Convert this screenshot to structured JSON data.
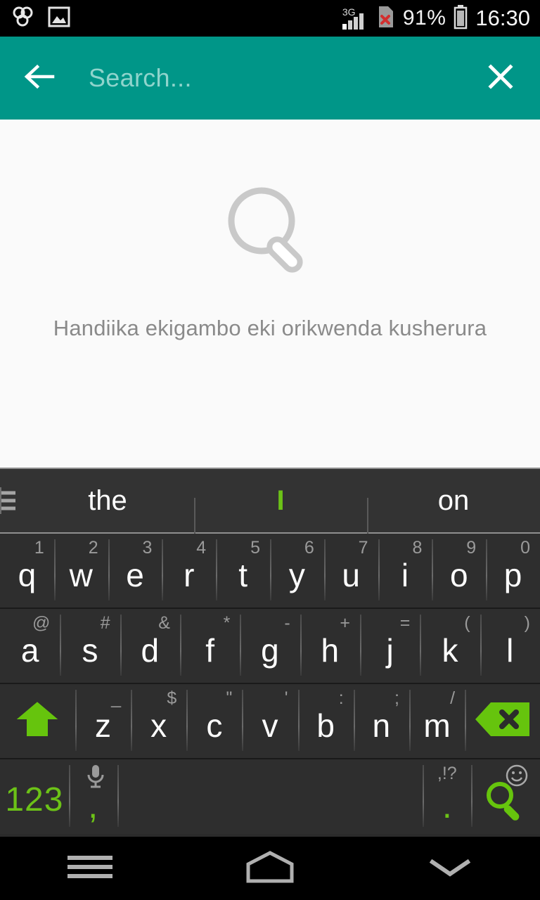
{
  "statusbar": {
    "left_icons": [
      {
        "name": "clover-app-icon"
      },
      {
        "name": "gallery-image-icon"
      }
    ],
    "network_type": "3G",
    "sim_status": "no-sim",
    "battery_percent": "91%",
    "time": "16:30"
  },
  "searchbar": {
    "background_color": "#009688",
    "back_icon": "arrow-left-icon",
    "placeholder": "Search...",
    "value": "",
    "close_icon": "close-x-icon"
  },
  "content": {
    "empty_icon": "magnifier-outline-icon",
    "empty_hint": "Handiika ekigambo eki orikwenda kusherura",
    "background_color": "#fafafa"
  },
  "keyboard": {
    "accent_color": "#6cc217",
    "background_color": "#2b2b2b",
    "suggestions_menu_icon": "hamburger-suggestions-icon",
    "suggestions": [
      {
        "label": "the",
        "highlighted": false
      },
      {
        "label": "I",
        "highlighted": true
      },
      {
        "label": "on",
        "highlighted": false
      }
    ],
    "rows": {
      "row1": [
        {
          "key": "q",
          "hint": "1"
        },
        {
          "key": "w",
          "hint": "2"
        },
        {
          "key": "e",
          "hint": "3"
        },
        {
          "key": "r",
          "hint": "4"
        },
        {
          "key": "t",
          "hint": "5"
        },
        {
          "key": "y",
          "hint": "6"
        },
        {
          "key": "u",
          "hint": "7"
        },
        {
          "key": "i",
          "hint": "8"
        },
        {
          "key": "o",
          "hint": "9"
        },
        {
          "key": "p",
          "hint": "0"
        }
      ],
      "row2": [
        {
          "key": "a",
          "hint": "@"
        },
        {
          "key": "s",
          "hint": "#"
        },
        {
          "key": "d",
          "hint": "&"
        },
        {
          "key": "f",
          "hint": "*"
        },
        {
          "key": "g",
          "hint": "-"
        },
        {
          "key": "h",
          "hint": "+"
        },
        {
          "key": "j",
          "hint": "="
        },
        {
          "key": "k",
          "hint": "("
        },
        {
          "key": "l",
          "hint": ")"
        }
      ],
      "row3": {
        "shift_icon": "shift-arrow-up-icon",
        "keys": [
          {
            "key": "z",
            "hint": "_"
          },
          {
            "key": "x",
            "hint": "$"
          },
          {
            "key": "c",
            "hint": "\""
          },
          {
            "key": "v",
            "hint": "'"
          },
          {
            "key": "b",
            "hint": ":"
          },
          {
            "key": "n",
            "hint": ";"
          },
          {
            "key": "m",
            "hint": "/"
          }
        ],
        "delete_icon": "backspace-delete-icon"
      },
      "row4": {
        "numbers_label": "123",
        "comma_label": ",",
        "comma_hint_icon": "microphone-icon",
        "space_label": "",
        "period_label": ".",
        "period_hint": ",!?",
        "enter_icon": "search-magnifier-icon",
        "enter_hint_icon": "emoji-smiley-icon"
      }
    }
  },
  "navbar": {
    "buttons": [
      {
        "name": "recents-menu-icon"
      },
      {
        "name": "home-icon"
      },
      {
        "name": "hide-keyboard-chevron-icon"
      }
    ]
  }
}
